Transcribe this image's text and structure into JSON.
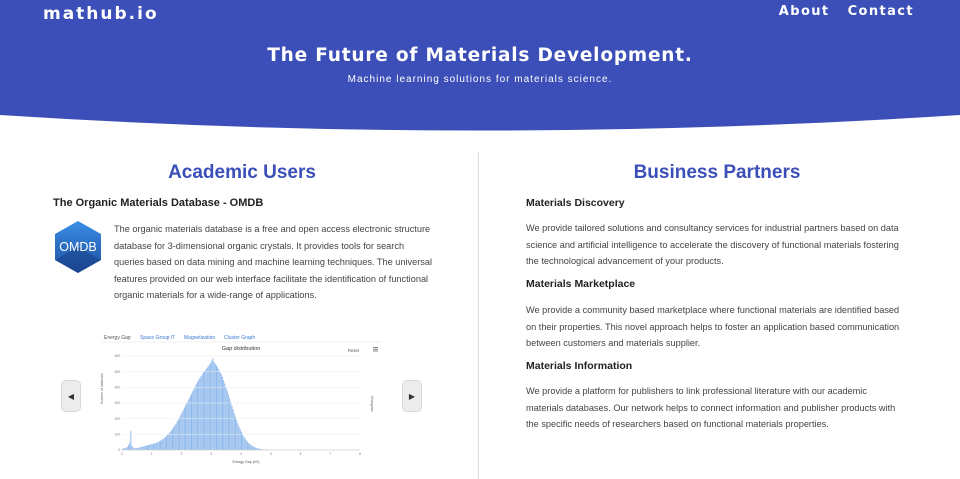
{
  "header": {
    "brand": "mathub.io",
    "nav": [
      "About",
      "Contact"
    ],
    "title": "The Future of Materials Development.",
    "subtitle": "Machine learning solutions for materials science.",
    "bg_color": "#3c4fb8"
  },
  "academic": {
    "heading": "Academic Users",
    "db_title": "The Organic Materials Database - OMDB",
    "logo_text": "OMDB",
    "description": [
      "The organic materials database is a free and open access electronic structure",
      "database for 3-dimensional organic crystals. It provides tools for search",
      "queries based on data mining and machine learning techniques. The universal",
      "features provided on our web interface facilitate the identification of functional",
      "organic materials for a wide-range of applications."
    ],
    "carousel": {
      "prev_icon": "chevron-left-icon",
      "next_icon": "chevron-right-icon",
      "tabs": [
        "Energy Gap",
        "Space Group IT",
        "Magnetization",
        "Cluster Graph"
      ],
      "reset_label": "Reset",
      "chart_data": {
        "type": "bar",
        "title": "Gap distribution",
        "xlabel": "Energy Gap (eV)",
        "ylabel": "Number of materials",
        "right_label": "Histogram",
        "xlim": [
          0,
          8
        ],
        "ylim": [
          0,
          600
        ],
        "x_ticks": [
          "0",
          "1",
          "2",
          "3",
          "4",
          "5",
          "6",
          "7",
          "8"
        ],
        "y_ticks": [
          "600",
          "500",
          "400",
          "300",
          "200",
          "100",
          "0"
        ],
        "bins_per_unit": 25,
        "values": [
          8,
          10,
          12,
          15,
          20,
          30,
          45,
          120,
          25,
          15,
          12,
          10,
          12,
          14,
          16,
          18,
          20,
          22,
          24,
          26,
          28,
          30,
          32,
          34,
          36,
          38,
          40,
          42,
          45,
          48,
          52,
          56,
          60,
          65,
          70,
          76,
          82,
          90,
          98,
          106,
          115,
          125,
          135,
          146,
          158,
          170,
          183,
          196,
          210,
          225,
          240,
          255,
          270,
          285,
          300,
          315,
          330,
          345,
          360,
          375,
          390,
          405,
          420,
          435,
          448,
          460,
          472,
          484,
          495,
          505,
          515,
          525,
          535,
          545,
          555,
          570,
          585,
          560,
          550,
          540,
          528,
          515,
          500,
          484,
          466,
          446,
          425,
          402,
          378,
          354,
          330,
          306,
          282,
          258,
          234,
          212,
          190,
          170,
          150,
          132,
          115,
          100,
          86,
          74,
          63,
          53,
          45,
          38,
          32,
          27,
          22,
          18,
          15,
          12,
          10,
          8,
          6,
          5,
          4,
          3,
          3,
          2,
          2,
          1,
          1,
          1
        ]
      }
    }
  },
  "business": {
    "heading": "Business Partners",
    "sections": [
      {
        "title": "Materials Discovery",
        "text": [
          "We provide tailored solutions and consultancy services for industrial partners based on data",
          "science and artificial intelligence to accelerate the discovery of functional materials fostering",
          "the technological advancement of your products."
        ]
      },
      {
        "title": "Materials Marketplace",
        "text": [
          "We provide a community based marketplace where functional materials are identified based",
          "on their properties. This novel approach helps to foster an application based communication",
          "between customers and materials supplier."
        ]
      },
      {
        "title": "Materials Information",
        "text": [
          "We provide a platform for publishers to link professional literature with our academic",
          "materials databases. Our network helps to connect information and publisher products with",
          "the specific needs of researchers based on functional materials properties."
        ]
      }
    ]
  }
}
